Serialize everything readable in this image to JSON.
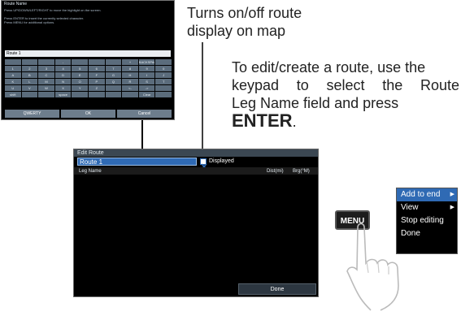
{
  "keyboard_screen": {
    "title": "Route Name",
    "instructions": [
      "Press UP/DOWN/LEFT/RIGHT to move the highlight on the screen.",
      "Press ENTER to insert the currently selected character.",
      "Press MENU for additional options."
    ],
    "name_field": "Route 1",
    "keys": [
      [
        "",
        "",
        "",
        "-",
        "",
        "",
        "",
        "+",
        "BACKSPACE",
        ""
      ],
      [
        "1",
        "2",
        "3",
        "4",
        "5",
        "6",
        "7",
        "8",
        "9",
        "0"
      ],
      [
        "A",
        "B",
        "C",
        "D",
        "E",
        "F",
        "G",
        "H",
        "I",
        "J"
      ],
      [
        "K",
        "L",
        "M",
        "N",
        "O",
        "P",
        "Q",
        "R",
        "S",
        "T"
      ],
      [
        "U",
        "V",
        "W",
        "X",
        "Y",
        "Z",
        "",
        "<-",
        "->",
        ""
      ],
      [
        "shift",
        "",
        "",
        "space",
        "",
        "",
        "",
        "",
        "Clear",
        ""
      ]
    ],
    "buttons": [
      "QWERTY",
      "OK",
      "Cancel"
    ]
  },
  "edit_route": {
    "title": "Edit Route",
    "route_name": "Route 1",
    "displayed_label": "Displayed",
    "columns": {
      "leg_name": "Leg Name",
      "dist": "Dist(mi)",
      "brg": "Brg(°M)"
    },
    "done_label": "Done"
  },
  "callouts": {
    "toggle_line1": "Turns on/off route",
    "toggle_line2": "display on map",
    "edit_line1": "To edit/create a route, use the",
    "edit_line2": "keypad to select the Route",
    "edit_line3_prefix": "Leg Name field and press",
    "edit_enter": "ENTER",
    "edit_period": "."
  },
  "menu_key_label": "MENU",
  "context_menu": {
    "items": [
      {
        "label": "Add to end",
        "submenu": true
      },
      {
        "label": "View",
        "submenu": true
      },
      {
        "label": "Stop editing",
        "submenu": false
      },
      {
        "label": "Done",
        "submenu": false
      }
    ]
  }
}
